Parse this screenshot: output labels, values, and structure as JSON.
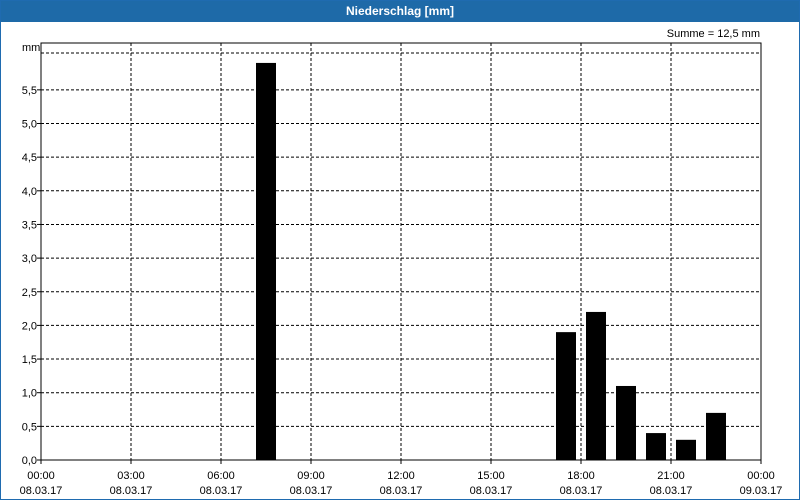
{
  "window": {
    "title": "Niederschlag [mm]"
  },
  "chart_data": {
    "type": "bar",
    "title": "Niederschlag [mm]",
    "ylabel": "mm",
    "xlabel": "",
    "annotation": "Summe = 12,5 mm",
    "ylim": [
      0,
      6.0
    ],
    "yticks": [
      "0,0",
      "0,5",
      "1,0",
      "1,5",
      "2,0",
      "2,5",
      "3,0",
      "3,5",
      "4,0",
      "4,5",
      "5,0",
      "5,5"
    ],
    "xlim_hours": [
      0,
      24
    ],
    "xticks": [
      {
        "time": "00:00",
        "date": "08.03.17"
      },
      {
        "time": "03:00",
        "date": "08.03.17"
      },
      {
        "time": "06:00",
        "date": "08.03.17"
      },
      {
        "time": "09:00",
        "date": "08.03.17"
      },
      {
        "time": "12:00",
        "date": "08.03.17"
      },
      {
        "time": "15:00",
        "date": "08.03.17"
      },
      {
        "time": "18:00",
        "date": "08.03.17"
      },
      {
        "time": "21:00",
        "date": "08.03.17"
      },
      {
        "time": "00:00",
        "date": "09.03.17"
      }
    ],
    "grid": true,
    "bar_color": "#000000",
    "series": [
      {
        "values": [
          {
            "hour": 7.5,
            "value": 5.9
          },
          {
            "hour": 17.5,
            "value": 1.9
          },
          {
            "hour": 18.5,
            "value": 2.2
          },
          {
            "hour": 19.5,
            "value": 1.1
          },
          {
            "hour": 20.5,
            "value": 0.4
          },
          {
            "hour": 21.5,
            "value": 0.3
          },
          {
            "hour": 22.5,
            "value": 0.7
          }
        ]
      }
    ]
  }
}
